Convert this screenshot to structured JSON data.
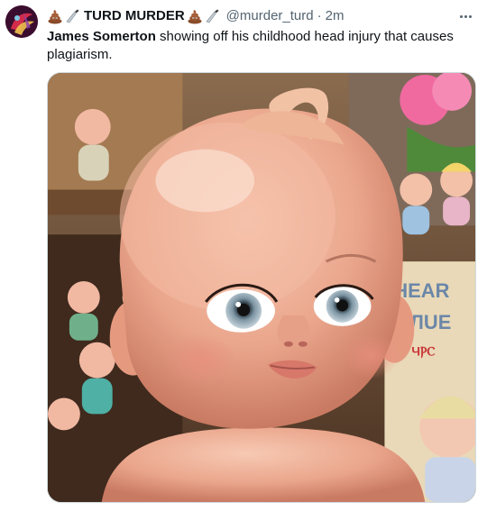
{
  "tweet": {
    "author": {
      "display_name": "TURD MURDER",
      "handle": "@murder_turd",
      "avatar_icon": "avatar-logo",
      "name_emojis": [
        "poop-emoji",
        "knife-emoji"
      ]
    },
    "separator": "·",
    "time": "2m",
    "more_icon": "more-icon",
    "text_mention": "James Somerton",
    "text_rest": " showing off his childhood head injury that causes plagiarism.",
    "media": {
      "kind": "image",
      "sign_lines": [
        "HEAR",
        "ㅿЛUE",
        "ЧⲢⲤ"
      ]
    }
  }
}
